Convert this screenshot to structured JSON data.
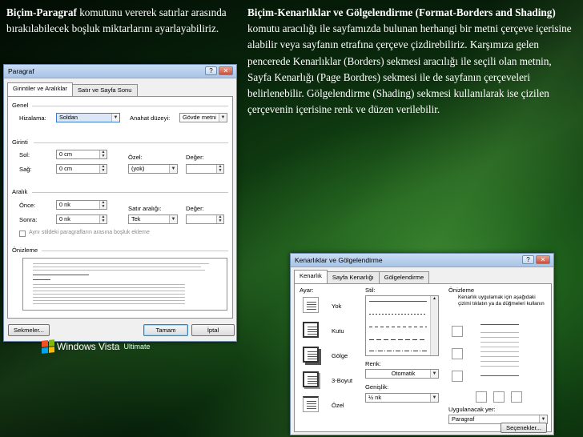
{
  "left_text": {
    "bold": "Biçim-Paragraf",
    "rest": " komutunu vererek satırlar arasında bırakılabilecek boşluk miktarlarını ayarlayabiliriz."
  },
  "right_text": {
    "bold": "Biçim-Kenarlıklar ve Gölgelendirme (Format-Borders and Shading)",
    "rest": " komutu aracılığı ile sayfamızda bulunan herhangi bir metni çerçeve içerisine alabilir veya sayfanın etrafına çerçeve çizdirebiliriz. Karşımıza gelen pencerede Kenarlıklar (Borders) sekmesi aracılığı ile seçili olan metnin, Sayfa Kenarlığı (Page Bordres) sekmesi ile de sayfanın çerçeveleri belirlenebilir. Gölgelendirme (Shading) sekmesi kullanılarak ise çizilen çerçevenin içerisine renk ve düzen verilebilir."
  },
  "paragraf_dialog": {
    "title": "Paragraf",
    "tabs": [
      "Girintiler ve Aralıklar",
      "Satır ve Sayfa Sonu"
    ],
    "genel_label": "Genel",
    "hizalama_label": "Hizalama:",
    "hizalama_value": "Soldan",
    "anahat_label": "Anahat düzeyi:",
    "anahat_value": "Gövde metni",
    "girinti_label": "Girinti",
    "sol_label": "Sol:",
    "sol_value": "0 cm",
    "sag_label": "Sağ:",
    "sag_value": "0 cm",
    "ozel_label": "Özel:",
    "ozel_value": "(yok)",
    "deger_label": "Değer:",
    "aralik_label": "Aralık",
    "once_label": "Önce:",
    "once_value": "0 nk",
    "sonra_label": "Sonra:",
    "sonra_value": "0 nk",
    "satir_aralik_label": "Satır aralığı:",
    "satir_aralik_value": "Tek",
    "checkbox_label": "Aynı stildeki paragrafların arasına boşluk ekleme",
    "onizleme_label": "Önizleme",
    "sekmeler_button": "Sekmeler...",
    "tamam_button": "Tamam",
    "iptal_button": "İptal"
  },
  "kenarlik_dialog": {
    "title": "Kenarlıklar ve Gölgelendirme",
    "tabs": [
      "Kenarlık",
      "Sayfa Kenarlığı",
      "Gölgelendirme"
    ],
    "ayar_label": "Ayar:",
    "settings": [
      "Yok",
      "Kutu",
      "Gölge",
      "3-Boyut",
      "Özel"
    ],
    "stil_label": "Stil:",
    "renk_label": "Renk:",
    "renk_value": "Otomatik",
    "genislik_label": "Genişlik:",
    "genislik_value": "½ nk",
    "onizleme_label": "Önizleme",
    "onizleme_hint": "Kenarlık uygulamak için aşağıdaki çizimi tıklatın ya da düğmeleri kullanın",
    "uygulanacak_label": "Uygulanacak yer:",
    "uygulanacak_value": "Paragraf",
    "secenekler_button": "Seçenekler..."
  },
  "vista": {
    "name": "Windows Vista",
    "edition": "Ultimate"
  }
}
